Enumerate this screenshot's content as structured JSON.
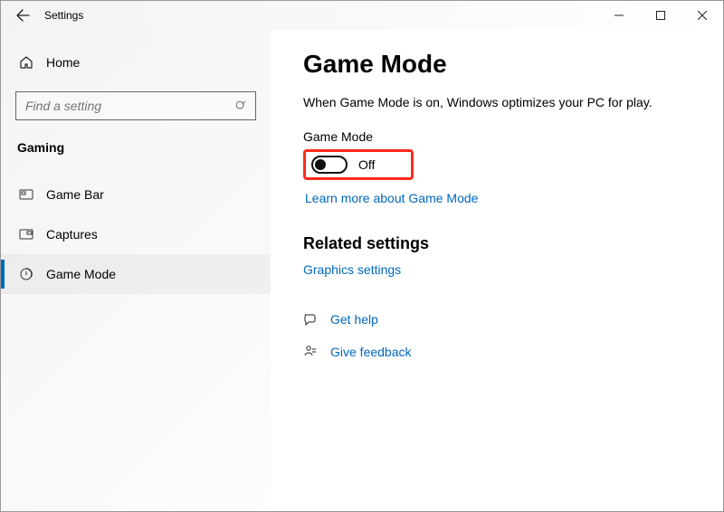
{
  "window": {
    "title": "Settings"
  },
  "sidebar": {
    "home_label": "Home",
    "search_placeholder": "Find a setting",
    "category": "Gaming",
    "items": [
      {
        "label": "Game Bar"
      },
      {
        "label": "Captures"
      },
      {
        "label": "Game Mode"
      }
    ],
    "selected_index": 2
  },
  "main": {
    "heading": "Game Mode",
    "description": "When Game Mode is on, Windows optimizes your PC for play.",
    "toggle_label": "Game Mode",
    "toggle_state": "Off",
    "learn_more": "Learn more about Game Mode",
    "related_heading": "Related settings",
    "related_link": "Graphics settings",
    "get_help": "Get help",
    "give_feedback": "Give feedback"
  }
}
